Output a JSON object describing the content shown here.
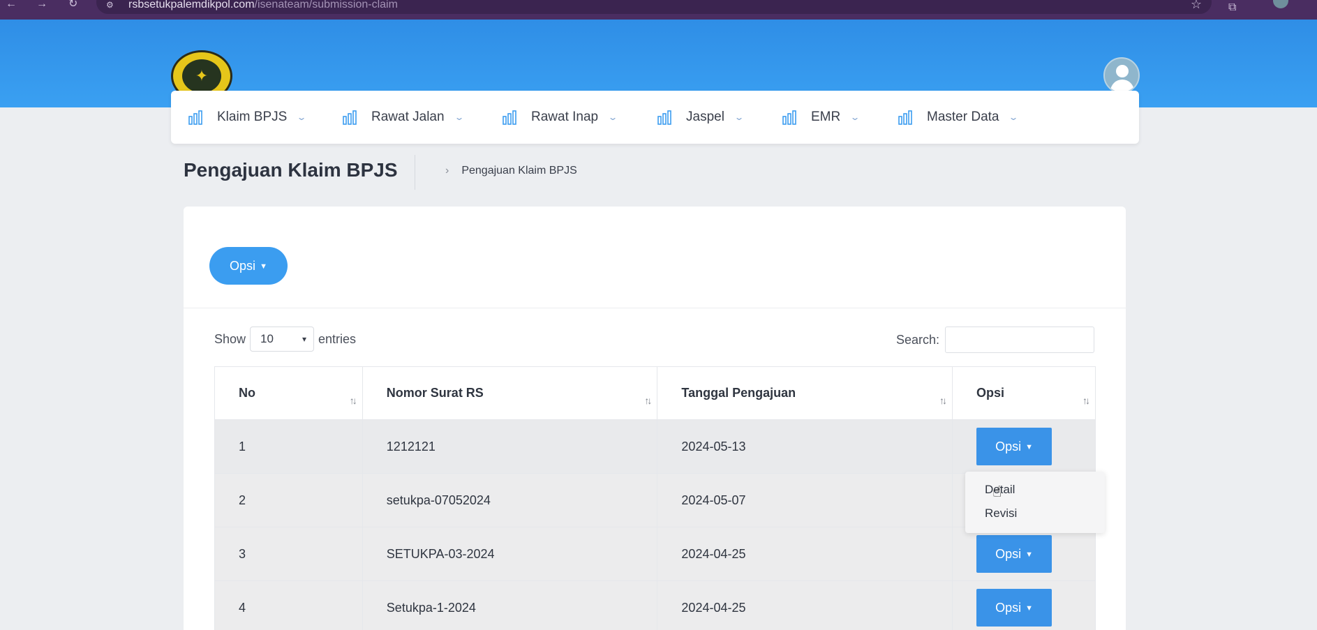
{
  "browser": {
    "url_host": "rsbsetukpalemdikpol.com",
    "url_path": "/isenateam/submission-claim"
  },
  "nav": {
    "items": [
      {
        "label": "Klaim BPJS"
      },
      {
        "label": "Rawat Jalan"
      },
      {
        "label": "Rawat Inap"
      },
      {
        "label": "Jaspel"
      },
      {
        "label": "EMR"
      },
      {
        "label": "Master Data"
      }
    ]
  },
  "page": {
    "title": "Pengajuan Klaim BPJS",
    "breadcrumb": "Pengajuan Klaim BPJS"
  },
  "toolbar": {
    "opsi_label": "Opsi"
  },
  "table_controls": {
    "show_label": "Show",
    "entries_value": "10",
    "entries_label": "entries",
    "search_label": "Search:"
  },
  "table": {
    "columns": [
      "No",
      "Nomor Surat RS",
      "Tanggal Pengajuan",
      "Opsi"
    ],
    "rows": [
      {
        "no": "1",
        "nomor": "1212121",
        "tanggal": "2024-05-13",
        "opsi": "Opsi"
      },
      {
        "no": "2",
        "nomor": "setukpa-07052024",
        "tanggal": "2024-05-07",
        "opsi": "Opsi"
      },
      {
        "no": "3",
        "nomor": "SETUKPA-03-2024",
        "tanggal": "2024-04-25",
        "opsi": "Opsi"
      },
      {
        "no": "4",
        "nomor": "Setukpa-1-2024",
        "tanggal": "2024-04-25",
        "opsi": "Opsi"
      }
    ]
  },
  "dropdown": {
    "items": [
      "Detail",
      "Revisi"
    ]
  },
  "colors": {
    "header": "#3aa0f2",
    "primary_button": "#3a93e8",
    "chrome": "#4a2d61"
  }
}
